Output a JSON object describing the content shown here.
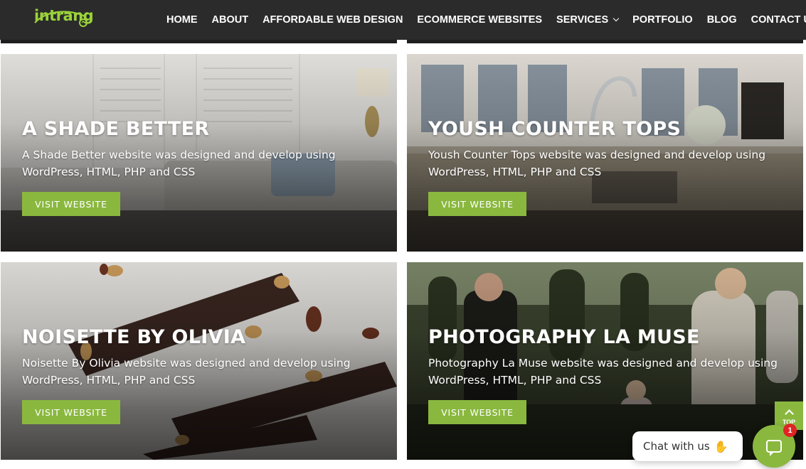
{
  "header": {
    "logo_text": "intrang",
    "nav": [
      {
        "label": "HOME"
      },
      {
        "label": "ABOUT"
      },
      {
        "label": "AFFORDABLE WEB DESIGN"
      },
      {
        "label": "ECOMMERCE WEBSITES"
      },
      {
        "label": "SERVICES",
        "has_dropdown": true
      },
      {
        "label": "PORTFOLIO"
      },
      {
        "label": "BLOG"
      },
      {
        "label": "CONTACT US"
      }
    ]
  },
  "colors": {
    "header_bg": "#2b2b2b",
    "accent_green": "#8ab83f",
    "logo_green": "#9bd23a",
    "badge_red": "#e02424"
  },
  "portfolio": [
    {
      "title": "A SHADE BETTER",
      "description": "A Shade Better website was designed and develop using WordPress, HTML, PHP and CSS",
      "button": "VISIT WEBSITE"
    },
    {
      "title": "YOUSH COUNTER TOPS",
      "description": "Yoush Counter Tops website was designed and develop using WordPress, HTML, PHP and CSS",
      "button": "VISIT WEBSITE"
    },
    {
      "title": "NOISETTE BY OLIVIA",
      "description": "Noisette By Olivia website was designed and develop using WordPress, HTML, PHP and CSS",
      "button": "VISIT WEBSITE"
    },
    {
      "title": "PHOTOGRAPHY LA MUSE",
      "description": "Photography La Muse website was designed and develop using WordPress, HTML, PHP and CSS",
      "button": "VISIT WEBSITE"
    }
  ],
  "back_to_top": {
    "label": "TOP",
    "icon": "chevron-up-icon"
  },
  "chat": {
    "label": "Chat with us",
    "wave_icon": "waving-hand-icon",
    "badge_count": "1"
  }
}
